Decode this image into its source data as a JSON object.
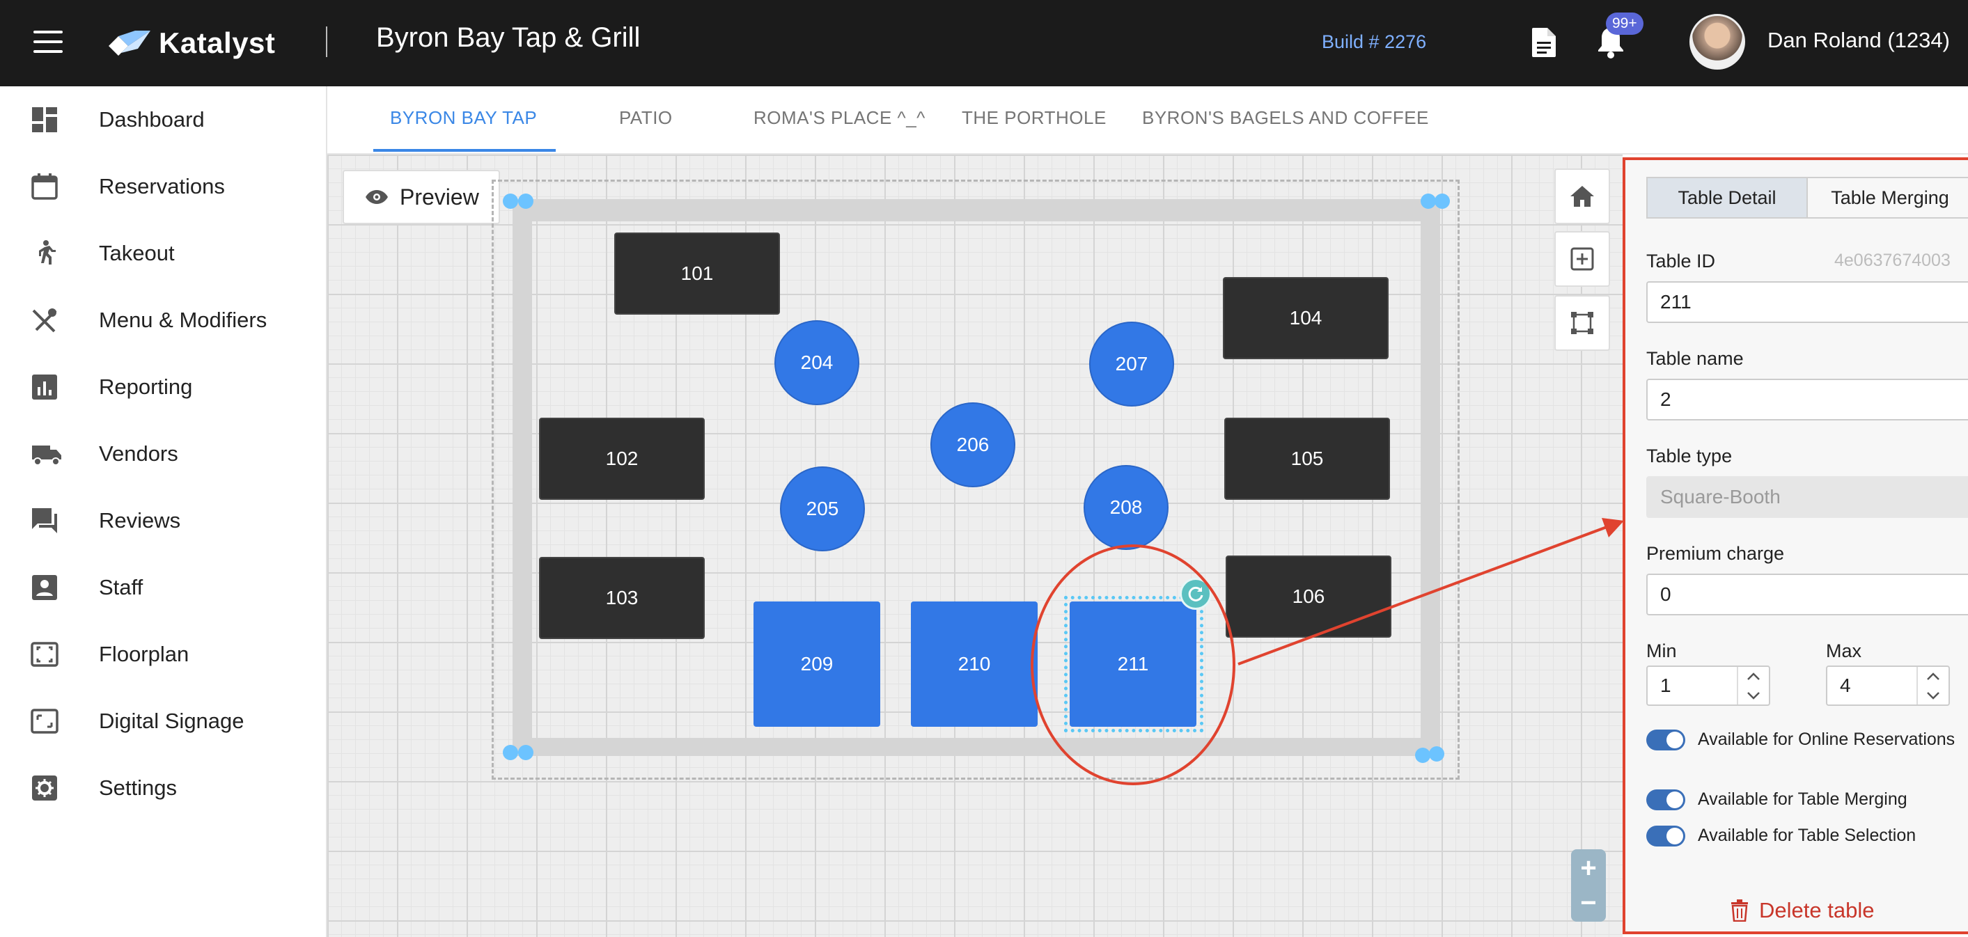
{
  "header": {
    "brand": "Katalyst",
    "restaurant": "Byron Bay Tap & Grill",
    "build": "Build # 2276",
    "notifications_badge": "99+",
    "user": "Dan Roland (1234)"
  },
  "sidebar": {
    "items": [
      {
        "label": "Dashboard",
        "icon": "dashboard-icon"
      },
      {
        "label": "Reservations",
        "icon": "calendar-icon"
      },
      {
        "label": "Takeout",
        "icon": "walking-person-icon"
      },
      {
        "label": "Menu & Modifiers",
        "icon": "utensils-icon"
      },
      {
        "label": "Reporting",
        "icon": "bar-chart-icon"
      },
      {
        "label": "Vendors",
        "icon": "truck-icon"
      },
      {
        "label": "Reviews",
        "icon": "chat-icon"
      },
      {
        "label": "Staff",
        "icon": "person-badge-icon"
      },
      {
        "label": "Floorplan",
        "icon": "floorplan-icon"
      },
      {
        "label": "Digital Signage",
        "icon": "signage-icon"
      },
      {
        "label": "Settings",
        "icon": "gear-icon"
      }
    ]
  },
  "tabs": [
    {
      "label": "BYRON BAY TAP",
      "active": true
    },
    {
      "label": "PATIO",
      "active": false
    },
    {
      "label": "ROMA'S PLACE ^_^",
      "active": false
    },
    {
      "label": "THE PORTHOLE",
      "active": false
    },
    {
      "label": "BYRON'S BAGELS AND COFFEE",
      "active": false
    }
  ],
  "canvas": {
    "preview_label": "Preview",
    "tables": {
      "t101": "101",
      "t102": "102",
      "t103": "103",
      "t104": "104",
      "t105": "105",
      "t106": "106",
      "t204": "204",
      "t205": "205",
      "t206": "206",
      "t207": "207",
      "t208": "208",
      "t209": "209",
      "t210": "210",
      "t211": "211"
    },
    "zoom_in": "+",
    "zoom_out": "−"
  },
  "panel": {
    "tab_detail": "Table Detail",
    "tab_merging": "Table Merging",
    "table_id_label": "Table ID",
    "table_uid": "4e0637674003",
    "table_id_value": "211",
    "table_name_label": "Table name",
    "table_name_value": "2",
    "table_type_label": "Table type",
    "table_type_value": "Square-Booth",
    "premium_label": "Premium charge",
    "premium_value": "0",
    "min_label": "Min",
    "min_value": "1",
    "max_label": "Max",
    "max_value": "4",
    "toggle_online": "Available for Online Reservations",
    "toggle_merging": "Available for Table Merging",
    "toggle_selection": "Available for Table Selection",
    "delete_label": "Delete table"
  },
  "colors": {
    "accent": "#3a87e6",
    "table_blue": "#3278e6",
    "table_dark": "#2f2f2f",
    "highlight_red": "#e0432f"
  }
}
